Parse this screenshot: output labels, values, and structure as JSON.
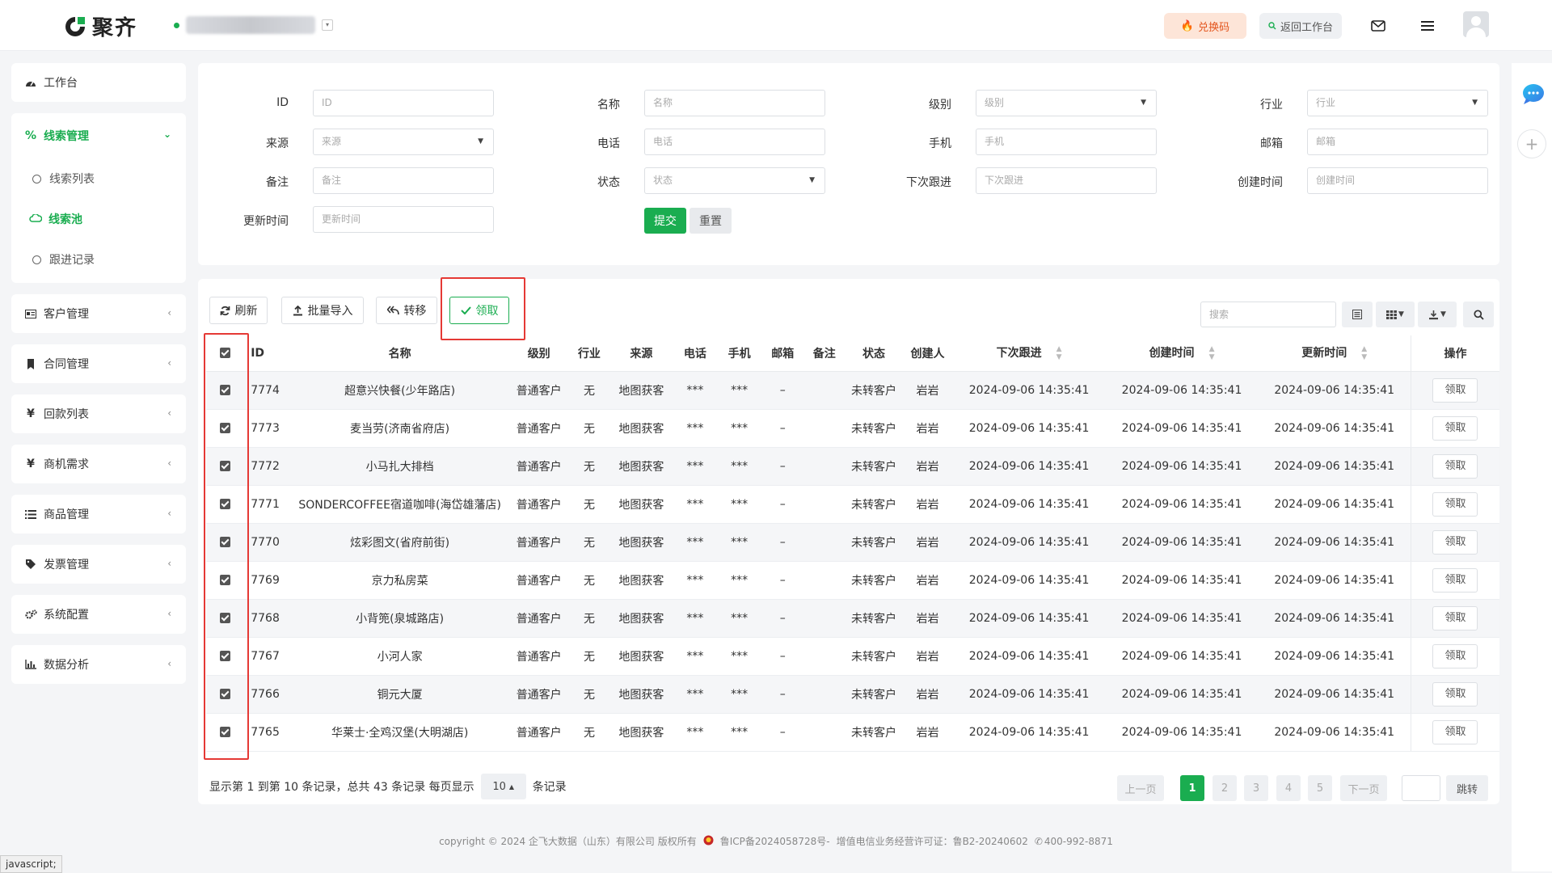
{
  "header": {
    "logo_text": "聚齐",
    "redeem_label": "兑换码",
    "back_label": "返回工作台"
  },
  "sidebar": {
    "workbench": "工作台",
    "leads": "线索管理",
    "leads_sub": [
      "线索列表",
      "线索池",
      "跟进记录"
    ],
    "groups": [
      "客户管理",
      "合同管理",
      "回款列表",
      "商机需求",
      "商品管理",
      "发票管理",
      "系统配置",
      "数据分析"
    ]
  },
  "filters": {
    "id": {
      "label": "ID",
      "placeholder": "ID"
    },
    "name": {
      "label": "名称",
      "placeholder": "名称"
    },
    "level": {
      "label": "级别",
      "placeholder": "级别"
    },
    "industry": {
      "label": "行业",
      "placeholder": "行业"
    },
    "source": {
      "label": "来源",
      "placeholder": "来源"
    },
    "phone": {
      "label": "电话",
      "placeholder": "电话"
    },
    "mobile": {
      "label": "手机",
      "placeholder": "手机"
    },
    "email": {
      "label": "邮箱",
      "placeholder": "邮箱"
    },
    "remark": {
      "label": "备注",
      "placeholder": "备注"
    },
    "status": {
      "label": "状态",
      "placeholder": "状态"
    },
    "next_follow": {
      "label": "下次跟进",
      "placeholder": "下次跟进"
    },
    "created": {
      "label": "创建时间",
      "placeholder": "创建时间"
    },
    "updated": {
      "label": "更新时间",
      "placeholder": "更新时间"
    },
    "submit_label": "提交",
    "reset_label": "重置"
  },
  "toolbar": {
    "refresh_label": "刷新",
    "import_label": "批量导入",
    "transfer_label": "转移",
    "claim_label": "领取",
    "search_placeholder": "搜索"
  },
  "table": {
    "columns": [
      "ID",
      "名称",
      "级别",
      "行业",
      "来源",
      "电话",
      "手机",
      "邮箱",
      "备注",
      "状态",
      "创建人",
      "下次跟进",
      "创建时间",
      "更新时间",
      "操作"
    ],
    "action_label": "领取",
    "rows": [
      {
        "id": "7774",
        "name": "超意兴快餐(少年路店)",
        "level": "普通客户",
        "industry": "无",
        "source": "地图获客",
        "phone": "***",
        "mobile": "***",
        "email": "–",
        "remark": "",
        "status": "未转客户",
        "creator": "岩岩",
        "next": "2024-09-06 14:35:41",
        "created": "2024-09-06 14:35:41",
        "updated": "2024-09-06 14:35:41"
      },
      {
        "id": "7773",
        "name": "麦当劳(济南省府店)",
        "level": "普通客户",
        "industry": "无",
        "source": "地图获客",
        "phone": "***",
        "mobile": "***",
        "email": "–",
        "remark": "",
        "status": "未转客户",
        "creator": "岩岩",
        "next": "2024-09-06 14:35:41",
        "created": "2024-09-06 14:35:41",
        "updated": "2024-09-06 14:35:41"
      },
      {
        "id": "7772",
        "name": "小马扎大排档",
        "level": "普通客户",
        "industry": "无",
        "source": "地图获客",
        "phone": "***",
        "mobile": "***",
        "email": "–",
        "remark": "",
        "status": "未转客户",
        "creator": "岩岩",
        "next": "2024-09-06 14:35:41",
        "created": "2024-09-06 14:35:41",
        "updated": "2024-09-06 14:35:41"
      },
      {
        "id": "7771",
        "name": "SONDERCOFFEE宿道咖啡(海岱雄藩店)",
        "level": "普通客户",
        "industry": "无",
        "source": "地图获客",
        "phone": "***",
        "mobile": "***",
        "email": "–",
        "remark": "",
        "status": "未转客户",
        "creator": "岩岩",
        "next": "2024-09-06 14:35:41",
        "created": "2024-09-06 14:35:41",
        "updated": "2024-09-06 14:35:41"
      },
      {
        "id": "7770",
        "name": "炫彩图文(省府前街)",
        "level": "普通客户",
        "industry": "无",
        "source": "地图获客",
        "phone": "***",
        "mobile": "***",
        "email": "–",
        "remark": "",
        "status": "未转客户",
        "creator": "岩岩",
        "next": "2024-09-06 14:35:41",
        "created": "2024-09-06 14:35:41",
        "updated": "2024-09-06 14:35:41"
      },
      {
        "id": "7769",
        "name": "京力私房菜",
        "level": "普通客户",
        "industry": "无",
        "source": "地图获客",
        "phone": "***",
        "mobile": "***",
        "email": "–",
        "remark": "",
        "status": "未转客户",
        "creator": "岩岩",
        "next": "2024-09-06 14:35:41",
        "created": "2024-09-06 14:35:41",
        "updated": "2024-09-06 14:35:41"
      },
      {
        "id": "7768",
        "name": "小背篼(泉城路店)",
        "level": "普通客户",
        "industry": "无",
        "source": "地图获客",
        "phone": "***",
        "mobile": "***",
        "email": "–",
        "remark": "",
        "status": "未转客户",
        "creator": "岩岩",
        "next": "2024-09-06 14:35:41",
        "created": "2024-09-06 14:35:41",
        "updated": "2024-09-06 14:35:41"
      },
      {
        "id": "7767",
        "name": "小河人家",
        "level": "普通客户",
        "industry": "无",
        "source": "地图获客",
        "phone": "***",
        "mobile": "***",
        "email": "–",
        "remark": "",
        "status": "未转客户",
        "creator": "岩岩",
        "next": "2024-09-06 14:35:41",
        "created": "2024-09-06 14:35:41",
        "updated": "2024-09-06 14:35:41"
      },
      {
        "id": "7766",
        "name": "铜元大厦",
        "level": "普通客户",
        "industry": "无",
        "source": "地图获客",
        "phone": "***",
        "mobile": "***",
        "email": "–",
        "remark": "",
        "status": "未转客户",
        "creator": "岩岩",
        "next": "2024-09-06 14:35:41",
        "created": "2024-09-06 14:35:41",
        "updated": "2024-09-06 14:35:41"
      },
      {
        "id": "7765",
        "name": "华莱士·全鸡汉堡(大明湖店)",
        "level": "普通客户",
        "industry": "无",
        "source": "地图获客",
        "phone": "***",
        "mobile": "***",
        "email": "–",
        "remark": "",
        "status": "未转客户",
        "creator": "岩岩",
        "next": "2024-09-06 14:35:41",
        "created": "2024-09-06 14:35:41",
        "updated": "2024-09-06 14:35:41"
      }
    ]
  },
  "pagination": {
    "info_prefix": "显示第 1 到第 10 条记录，总共 43 条记录 每页显示",
    "page_size": "10",
    "info_suffix": "条记录",
    "prev_label": "上一页",
    "pages": [
      "1",
      "2",
      "3",
      "4",
      "5"
    ],
    "next_label": "下一页",
    "jump_label": "跳转"
  },
  "footer": {
    "copyright": "copyright © 2024 企飞大数据（山东）有限公司 版权所有",
    "icp": "鲁ICP备2024058728号-",
    "license": "增值电信业务经营许可证：鲁B2-20240602",
    "phone": "400-992-8871"
  },
  "statusbar": {
    "text": "javascript;"
  },
  "colors": {
    "accent": "#1aad50",
    "highlight": "#e53935",
    "redeem": "#e3541c"
  }
}
